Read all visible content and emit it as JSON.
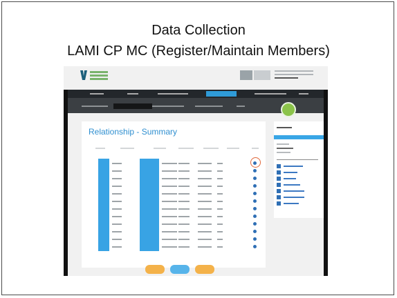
{
  "slide": {
    "title_line1": "Data Collection",
    "title_line2": "LAMI CP MC (Register/Maintain Members)"
  },
  "screenshot": {
    "panel_title": "Relationship - Summary",
    "colors": {
      "nav_dark": "#23272b",
      "nav_active": "#2f9bd8",
      "subnav_dark": "#3b3f43",
      "accent_blue": "#38a3e4",
      "title_blue": "#2f8fd0",
      "highlight_circle": "#e0673a",
      "badge_green": "#8bc34a",
      "button_orange": "#f4b24a",
      "button_blue": "#57b4ea"
    },
    "icons": [
      "logo-icon",
      "status-dot-icon",
      "link-icon",
      "user-avatar-icon"
    ]
  }
}
